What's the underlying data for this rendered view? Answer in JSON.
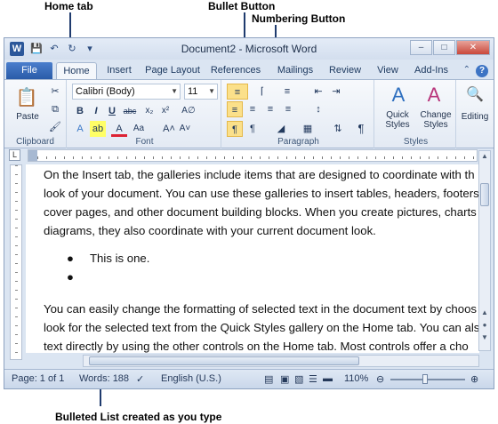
{
  "annotations": {
    "home_tab": "Home tab",
    "bullet_button": "Bullet Button",
    "numbering_button": "Numbering Button",
    "bulleted_list": "Bulleted List created as you type"
  },
  "window": {
    "title": "Document2 - Microsoft Word",
    "app_icon": "W"
  },
  "tabs": [
    "File",
    "Home",
    "Insert",
    "Page Layout",
    "References",
    "Mailings",
    "Review",
    "View",
    "Add-Ins"
  ],
  "ribbon": {
    "clipboard": {
      "label": "Clipboard",
      "paste": "Paste"
    },
    "font": {
      "label": "Font",
      "font_name": "Calibri (Body)",
      "font_size": "11"
    },
    "paragraph": {
      "label": "Paragraph"
    },
    "styles": {
      "label": "Styles",
      "quick_styles": "Quick Styles",
      "change_styles": "Change Styles"
    },
    "editing": {
      "label": "Editing"
    }
  },
  "document": {
    "para1": [
      "On the Insert tab, the galleries include items that are designed to coordinate with th",
      "look of your document.  You can use these galleries to insert tables, headers, footers",
      "cover pages, and other document building blocks. When you create pictures, charts",
      "diagrams, they also coordinate with your current document look."
    ],
    "bullets": [
      "This is one.",
      ""
    ],
    "para2": [
      "You can easily change the formatting of selected text in the document text by choos",
      "look for the selected text from the Quick Styles gallery on the Home tab. You can als",
      "text directly by using the other controls on the Home tab. Most controls offer a cho"
    ]
  },
  "status": {
    "page": "Page: 1 of 1",
    "words": "Words: 188",
    "language": "English (U.S.)",
    "zoom": "110%"
  },
  "colors": {
    "file_tab": "#2a5ba8",
    "ribbon_bg": "#e3eaf4",
    "selected_button": "#fbe08a"
  }
}
